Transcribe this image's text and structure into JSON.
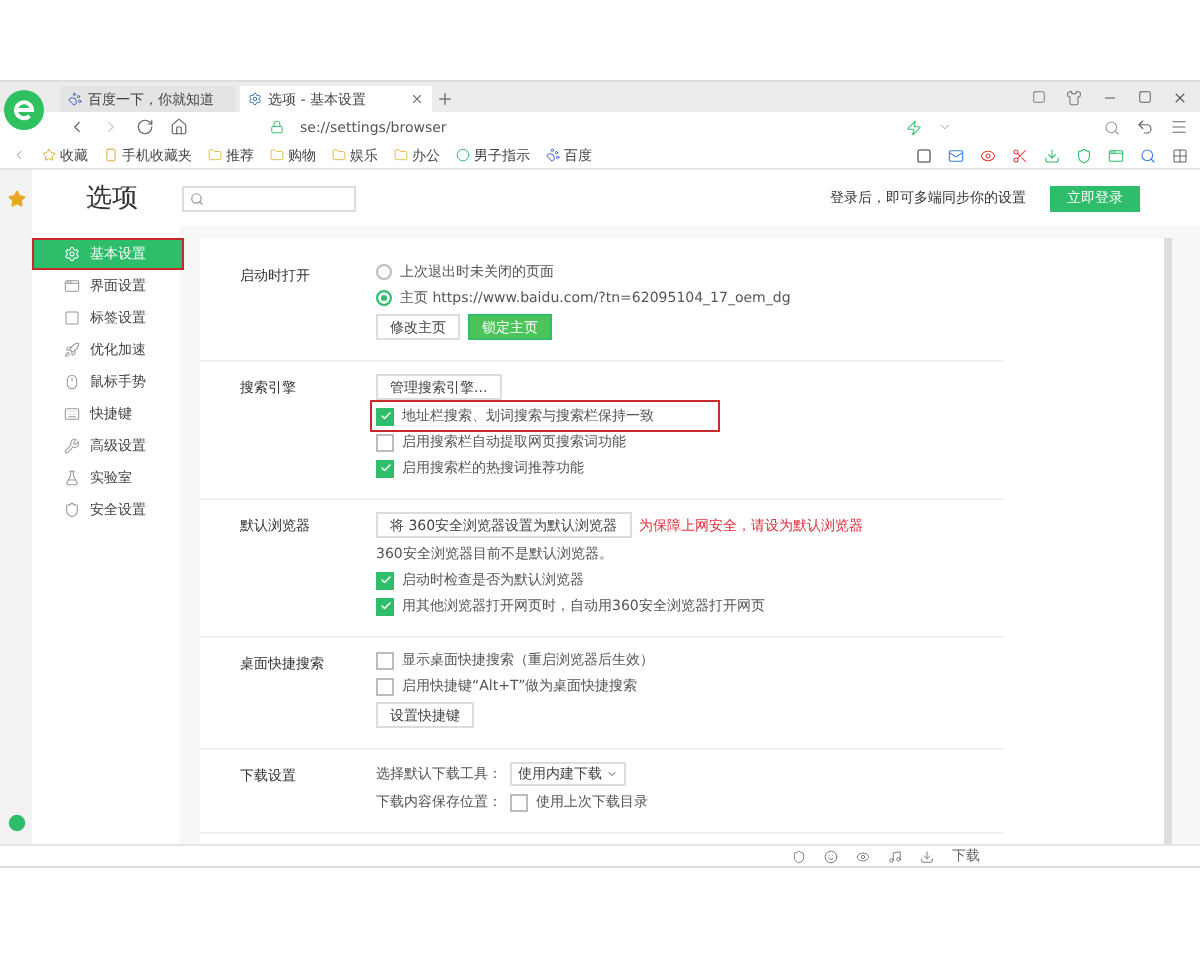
{
  "tabs": [
    {
      "label": "百度一下，你就知道",
      "selected": false
    },
    {
      "label": "选项 - 基本设置",
      "selected": true
    }
  ],
  "address": {
    "value": "se://settings/browser"
  },
  "bookmarks": [
    {
      "label": "收藏"
    },
    {
      "label": "手机收藏夹"
    },
    {
      "label": "推荐"
    },
    {
      "label": "购物"
    },
    {
      "label": "娱乐"
    },
    {
      "label": "办公"
    },
    {
      "label": "男子指示"
    },
    {
      "label": "百度"
    }
  ],
  "title": "选项",
  "login": {
    "text": "登录后，即可多端同步你的设置",
    "button": "立即登录"
  },
  "sidebar": {
    "items": [
      {
        "label": "基本设置",
        "selected": true,
        "highlighted": true
      },
      {
        "label": "界面设置",
        "selected": false,
        "highlighted": false
      },
      {
        "label": "标签设置",
        "selected": false,
        "highlighted": false
      },
      {
        "label": "优化加速",
        "selected": false,
        "highlighted": false
      },
      {
        "label": "鼠标手势",
        "selected": false,
        "highlighted": false
      },
      {
        "label": "快捷键",
        "selected": false,
        "highlighted": false
      },
      {
        "label": "高级设置",
        "selected": false,
        "highlighted": false
      },
      {
        "label": "实验室",
        "selected": false,
        "highlighted": false
      },
      {
        "label": "安全设置",
        "selected": false,
        "highlighted": false
      }
    ]
  },
  "sections": [
    {
      "title": "启动时打开",
      "rows": [
        {
          "kind": "radio",
          "label": "上次退出时未关闭的页面",
          "selected": false
        },
        {
          "kind": "radio",
          "label": "主页  https://www.baidu.com/?tn=62095104_17_oem_dg",
          "selected": true
        },
        {
          "kind": "buttons",
          "buttons": [
            {
              "label": "修改主页",
              "primary": false
            },
            {
              "label": "锁定主页",
              "primary": true
            }
          ]
        }
      ]
    },
    {
      "title": "搜索引擎",
      "rows": [
        {
          "kind": "buttons",
          "buttons": [
            {
              "label": "管理搜索引擎...",
              "primary": false
            }
          ]
        },
        {
          "kind": "checkbox",
          "label": "地址栏搜索、划词搜索与搜索栏保持一致",
          "checked": true,
          "highlighted": true
        },
        {
          "kind": "checkbox",
          "label": "启用搜索栏自动提取网页搜索词功能",
          "checked": false,
          "highlighted": false
        },
        {
          "kind": "checkbox",
          "label": "启用搜索栏的热搜词推荐功能",
          "checked": true,
          "highlighted": false
        }
      ]
    },
    {
      "title": "默认浏览器",
      "rows": [
        {
          "kind": "buttons",
          "buttons": [
            {
              "label": "将 360安全浏览器设置为默认浏览器",
              "primary": false
            }
          ],
          "warning": "为保障上网安全，请设为默认浏览器"
        },
        {
          "kind": "text",
          "label": "360安全浏览器目前不是默认浏览器。"
        },
        {
          "kind": "checkbox",
          "label": "启动时检查是否为默认浏览器",
          "checked": true,
          "highlighted": false
        },
        {
          "kind": "checkbox",
          "label": "用其他浏览器打开网页时，自动用360安全浏览器打开网页",
          "checked": true,
          "highlighted": false
        }
      ]
    },
    {
      "title": "桌面快捷搜索",
      "rows": [
        {
          "kind": "checkbox",
          "label": "显示桌面快捷搜索（重启浏览器后生效）",
          "checked": false,
          "highlighted": false
        },
        {
          "kind": "checkbox",
          "label": "启用快捷键“Alt+T”做为桌面快捷搜索",
          "checked": false,
          "highlighted": false
        },
        {
          "kind": "buttons",
          "buttons": [
            {
              "label": "设置快捷键",
              "primary": false
            }
          ]
        }
      ]
    },
    {
      "title": "下载设置",
      "rows": [
        {
          "kind": "select",
          "label": "选择默认下载工具：",
          "value": "使用内建下载"
        },
        {
          "kind": "pathcheck",
          "label": "下载内容保存位置：",
          "option": "使用上次下载目录",
          "checked": false
        }
      ]
    }
  ],
  "status": {
    "download": "下载"
  }
}
